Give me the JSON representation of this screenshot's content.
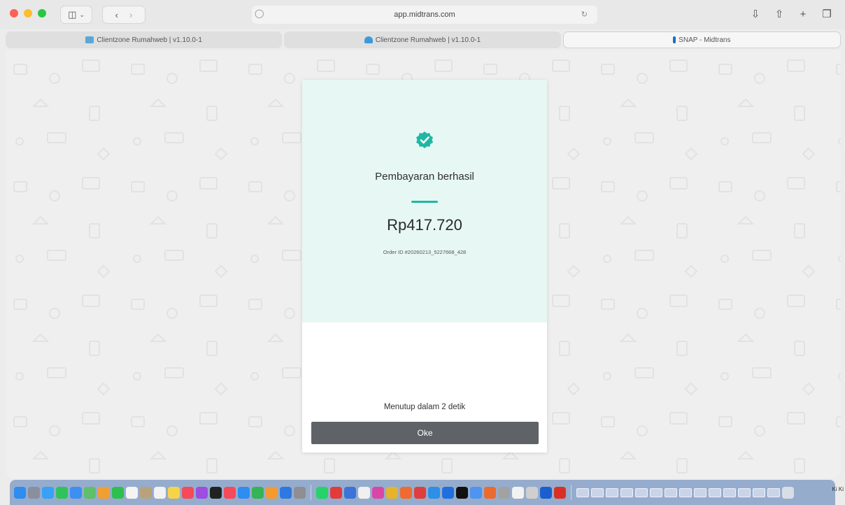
{
  "browser": {
    "address": "app.midtrans.com",
    "tabs": [
      {
        "label": "Clientzone Rumahweb | v1.10.0-1",
        "active": false
      },
      {
        "label": "Clientzone Rumahweb | v1.10.0-1",
        "active": false
      },
      {
        "label": "SNAP - Midtrans",
        "active": true
      }
    ]
  },
  "payment": {
    "status": "Pembayaran berhasil",
    "amount": "Rp417.720",
    "order_id": "Order ID #20260213_5227668_428",
    "closing_text": "Menutup dalam 2 detik",
    "ok_label": "Oke"
  },
  "colors": {
    "success": "#1fb7a4",
    "modal_top": "#e7f7f4",
    "button": "#5f6368"
  },
  "dock": {
    "edge_text": "Ki Ki"
  }
}
